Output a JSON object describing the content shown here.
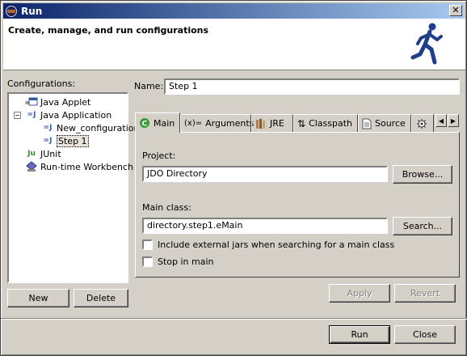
{
  "window": {
    "title": "Run",
    "close_glyph": "✕"
  },
  "banner": {
    "headline": "Create, manage, and run configurations",
    "icon": "running-man-icon"
  },
  "configurations": {
    "label": "Configurations:",
    "tree": [
      {
        "label": "Java Applet",
        "icon": "applet-icon"
      },
      {
        "label": "Java Application",
        "icon": "java-app-icon",
        "expander": "−"
      },
      {
        "label": "New_configuration",
        "icon": "java-config-icon"
      },
      {
        "label": "Step 1",
        "icon": "java-config-icon",
        "selected": true
      },
      {
        "label": "JUnit",
        "icon": "junit-icon"
      },
      {
        "label": "Run-time Workbench",
        "icon": "workbench-icon"
      }
    ],
    "new_label": "New",
    "delete_label": "Delete"
  },
  "name": {
    "label": "Name:",
    "value": "Step 1"
  },
  "tabs": [
    {
      "label": "Main",
      "icon": "main-class-icon",
      "active": true
    },
    {
      "label": "Arguments",
      "icon": "arguments-icon",
      "glyph": "(x)="
    },
    {
      "label": "JRE",
      "icon": "jre-icon"
    },
    {
      "label": "Classpath",
      "icon": "classpath-icon",
      "glyph": "⇅"
    },
    {
      "label": "Source",
      "icon": "source-icon"
    },
    {
      "label": "",
      "icon": "common-icon"
    }
  ],
  "tab_scroll": {
    "left": "◀",
    "right": "▶"
  },
  "main_tab": {
    "project_label": "Project:",
    "project_value": "JDO Directory",
    "browse_label": "Browse...",
    "main_class_label": "Main class:",
    "main_class_value": "directory.step1.eMain",
    "search_label": "Search...",
    "include_external_label": "Include external jars when searching for a main class",
    "include_external_checked": false,
    "stop_in_main_label": "Stop in main",
    "stop_in_main_checked": false
  },
  "apply_label": "Apply",
  "revert_label": "Revert",
  "run_label": "Run",
  "close_label": "Close",
  "colors": {
    "title_start": "#0a246a",
    "title_end": "#a6caf0",
    "face": "#d4d0c8"
  }
}
